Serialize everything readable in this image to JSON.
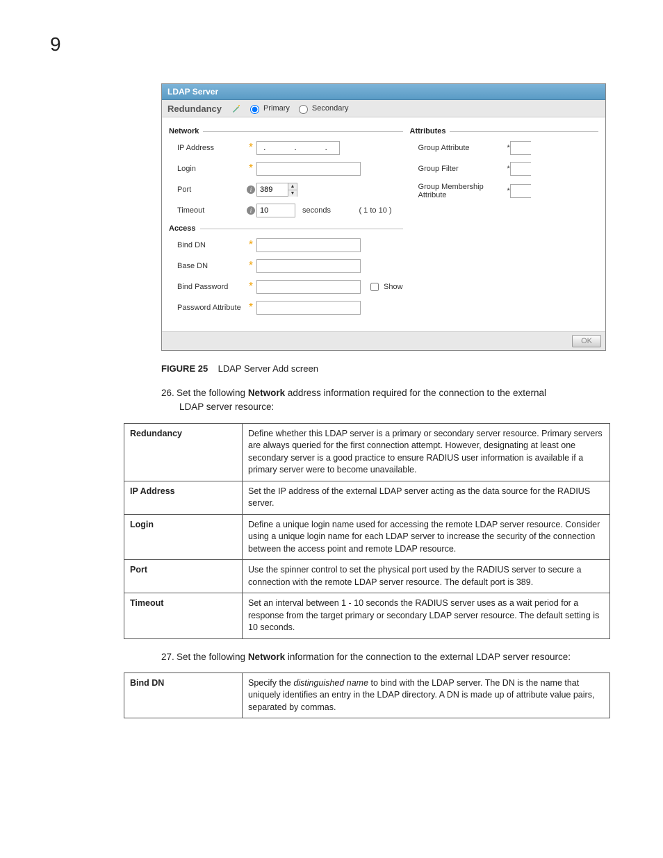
{
  "chapter": "9",
  "panel": {
    "title": "LDAP Server",
    "redundancy": {
      "label": "Redundancy",
      "primary": "Primary",
      "secondary": "Secondary"
    },
    "network": {
      "legend": "Network",
      "ip_label": "IP Address",
      "login_label": "Login",
      "port_label": "Port",
      "port_value": "389",
      "timeout_label": "Timeout",
      "timeout_value": "10",
      "timeout_unit": "seconds",
      "timeout_range": "( 1 to 10 )"
    },
    "access": {
      "legend": "Access",
      "bind_dn": "Bind DN",
      "base_dn": "Base DN",
      "bind_pw": "Bind Password",
      "show": "Show",
      "pw_attr": "Password Attribute"
    },
    "attributes": {
      "legend": "Attributes",
      "group_attr": "Group Attribute",
      "group_filter": "Group Filter",
      "group_mem": "Group Membership Attribute"
    },
    "ok": "OK"
  },
  "caption": {
    "label": "FIGURE 25",
    "text": "LDAP Server Add screen"
  },
  "step26": {
    "num": "26.",
    "pre": "Set the following ",
    "bold": "Network",
    "post": " address information required for the connection to the external LDAP server resource:"
  },
  "table1": {
    "r1": {
      "k": "Redundancy",
      "v": "Define whether this LDAP server is a primary or secondary server resource. Primary servers are always queried for the first connection attempt. However, designating at least one secondary server is a good practice to ensure RADIUS user information is available if a primary server were to become unavailable."
    },
    "r2": {
      "k": "IP Address",
      "v": "Set the IP address of the external LDAP server acting as the data source for the RADIUS server."
    },
    "r3": {
      "k": "Login",
      "v": "Define a unique login name used for accessing the remote LDAP server resource. Consider using a unique login name for each LDAP server to increase the security of the connection between the access point and remote LDAP resource."
    },
    "r4": {
      "k": "Port",
      "v": "Use the spinner control to set the physical port used by the RADIUS server to secure a connection with the remote LDAP server resource. The default port is 389."
    },
    "r5": {
      "k": "Timeout",
      "v": "Set an interval between 1 - 10 seconds the RADIUS server uses as a wait period for a response from the target primary or secondary LDAP server resource. The default setting is 10 seconds."
    }
  },
  "step27": {
    "num": "27.",
    "pre": "Set the following ",
    "bold": "Network",
    "post": " information for the connection to the external LDAP server resource:"
  },
  "table2": {
    "r1": {
      "k": "Bind DN",
      "pre": "Specify the ",
      "italic": "distinguished name",
      "post": " to bind with the LDAP server. The DN is the name that uniquely identifies an entry in the LDAP directory. A DN is made up of attribute value pairs, separated by commas."
    }
  }
}
